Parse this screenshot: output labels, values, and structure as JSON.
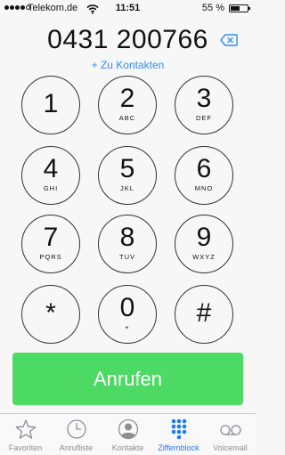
{
  "status_bar": {
    "carrier": "Telekom.de",
    "time": "11:51",
    "battery_percent_text": "55 %",
    "battery_level": 0.55,
    "signal_bars_filled": 4,
    "signal_bars_total": 5
  },
  "dialer": {
    "number": "0431 200766",
    "add_contact": "+ Zu Kontakten",
    "delete_icon": "backspace-icon"
  },
  "keypad": {
    "keys": [
      {
        "digit": "1",
        "letters": ""
      },
      {
        "digit": "2",
        "letters": "ABC"
      },
      {
        "digit": "3",
        "letters": "DEF"
      },
      {
        "digit": "4",
        "letters": "GHI"
      },
      {
        "digit": "5",
        "letters": "JKL"
      },
      {
        "digit": "6",
        "letters": "MNO"
      },
      {
        "digit": "7",
        "letters": "PQRS"
      },
      {
        "digit": "8",
        "letters": "TUV"
      },
      {
        "digit": "9",
        "letters": "WXYZ"
      },
      {
        "digit": "*",
        "letters": ""
      },
      {
        "digit": "0",
        "letters": "+"
      },
      {
        "digit": "#",
        "letters": ""
      }
    ]
  },
  "call_button": {
    "label": "Anrufen",
    "color": "#4cd964"
  },
  "tab_bar": {
    "active_color": "#1a7bfb",
    "inactive_color": "#8e8e93",
    "tabs": [
      {
        "label": "Favoriten",
        "icon": "star-icon",
        "active": false
      },
      {
        "label": "Anrufliste",
        "icon": "clock-icon",
        "active": false
      },
      {
        "label": "Kontakte",
        "icon": "contact-icon",
        "active": false
      },
      {
        "label": "Ziffernblock",
        "icon": "keypad-icon",
        "active": true
      },
      {
        "label": "Voicemail",
        "icon": "voicemail-icon",
        "active": false
      }
    ]
  }
}
